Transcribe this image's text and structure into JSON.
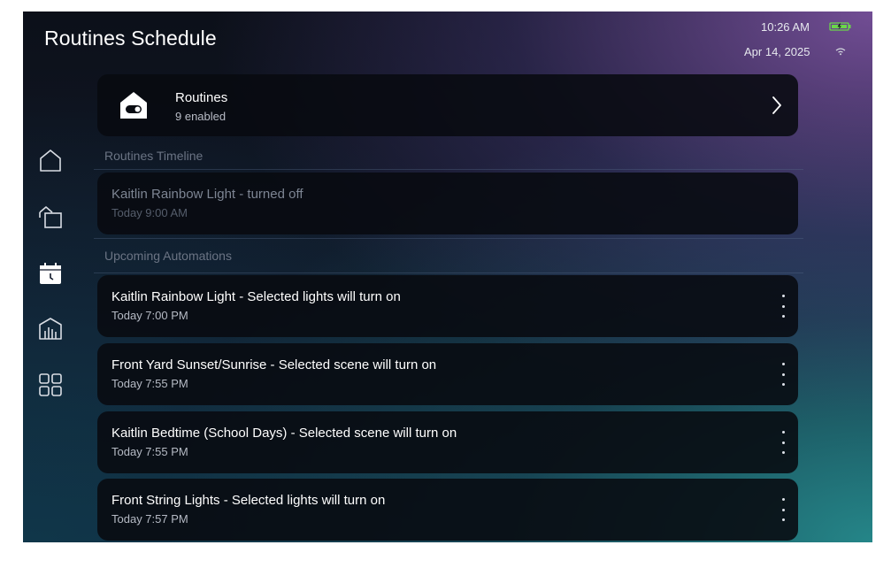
{
  "header": {
    "title": "Routines Schedule",
    "time": "10:26 AM",
    "date": "Apr 14, 2025",
    "battery_icon": "battery-charging-icon",
    "wifi_icon": "wifi-icon"
  },
  "sidebar": {
    "items": [
      {
        "name": "home",
        "icon": "home-icon"
      },
      {
        "name": "rooms",
        "icon": "rooms-icon"
      },
      {
        "name": "schedule",
        "icon": "calendar-clock-icon",
        "active": true
      },
      {
        "name": "energy",
        "icon": "building-chart-icon"
      },
      {
        "name": "apps",
        "icon": "grid-icon"
      }
    ]
  },
  "routines_card": {
    "title": "Routines",
    "subtitle": "9 enabled",
    "icon": "home-toggle-icon"
  },
  "timeline": {
    "label": "Routines Timeline",
    "items": [
      {
        "title": "Kaitlin Rainbow Light - turned off",
        "time": "Today 9:00 AM"
      }
    ]
  },
  "upcoming": {
    "label": "Upcoming Automations",
    "items": [
      {
        "title": "Kaitlin Rainbow Light - Selected lights will turn on",
        "time": "Today 7:00 PM"
      },
      {
        "title": "Front Yard Sunset/Sunrise - Selected scene will turn on",
        "time": "Today 7:55 PM"
      },
      {
        "title": "Kaitlin Bedtime (School Days) - Selected scene will turn on",
        "time": "Today 7:55 PM"
      },
      {
        "title": "Front String Lights - Selected lights will turn on",
        "time": "Today 7:57 PM"
      }
    ]
  },
  "colors": {
    "card_bg": "#08090f",
    "text_muted": "#6b7484",
    "accent_battery": "#6bd64a"
  }
}
